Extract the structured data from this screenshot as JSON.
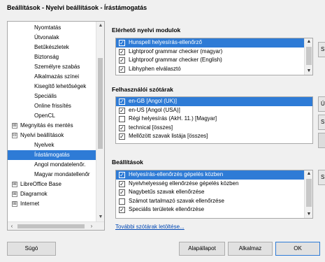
{
  "window": {
    "title": "Beállítások - Nyelvi beállítások - Írástámogatás"
  },
  "tree": {
    "items": [
      {
        "label": "Nyomtatás",
        "level": 2
      },
      {
        "label": "Útvonalak",
        "level": 2
      },
      {
        "label": "Betűkészletek",
        "level": 2
      },
      {
        "label": "Biztonság",
        "level": 2
      },
      {
        "label": "Személyre szabás",
        "level": 2
      },
      {
        "label": "Alkalmazás színei",
        "level": 2
      },
      {
        "label": "Kisegítő lehetőségek",
        "level": 2
      },
      {
        "label": "Speciális",
        "level": 2
      },
      {
        "label": "Online frissítés",
        "level": 2
      },
      {
        "label": "OpenCL",
        "level": 2
      },
      {
        "label": "Megnyitás és mentés",
        "level": 1,
        "expander": "⊞"
      },
      {
        "label": "Nyelvi beállítások",
        "level": 1,
        "expander": "⊟"
      },
      {
        "label": "Nyelvek",
        "level": 2
      },
      {
        "label": "Írástámogatás",
        "level": 2,
        "selected": true
      },
      {
        "label": "Angol mondatelenőr.",
        "level": 2
      },
      {
        "label": "Magyar mondatellenőr",
        "level": 2
      },
      {
        "label": "LibreOffice Base",
        "level": 1,
        "expander": "⊞"
      },
      {
        "label": "Diagramok",
        "level": 1,
        "expander": "⊞"
      },
      {
        "label": "Internet",
        "level": 1,
        "expander": "⊞"
      }
    ]
  },
  "modules": {
    "title": "Elérhető nyelvi modulok",
    "items": [
      {
        "label": "Hunspell helyesírás-ellenőrző",
        "checked": true,
        "selected": true
      },
      {
        "label": "Lightproof grammar checker (magyar)",
        "checked": true
      },
      {
        "label": "Lightproof grammar checker (English)",
        "checked": true
      },
      {
        "label": "Libhyphen elválasztó",
        "checked": true
      }
    ]
  },
  "dictionaries": {
    "title": "Felhasználói szótárak",
    "items": [
      {
        "label": "en-GB [Angol (UK)]",
        "checked": true,
        "selected": true
      },
      {
        "label": "en-US [Angol (USA)]",
        "checked": true
      },
      {
        "label": "Régi helyesírás (AkH. 11.) [Magyar]",
        "checked": false
      },
      {
        "label": "technical [összes]",
        "checked": true
      },
      {
        "label": "Mellőzött szavak listája [összes]",
        "checked": true
      }
    ]
  },
  "options": {
    "title": "Beállítások",
    "items": [
      {
        "label": "Helyesírás-ellenőrzés gépelés közben",
        "checked": true,
        "selected": true
      },
      {
        "label": "Nyelvhelyesség ellenőrzése gépelés közben",
        "checked": true
      },
      {
        "label": "Nagybetűs szavak ellenőrzése",
        "checked": true
      },
      {
        "label": "Számot tartalmazó szavak ellenőrzése",
        "checked": false
      },
      {
        "label": "Speciális területek ellenőrzése",
        "checked": true
      }
    ],
    "more_link": "További szótárak letöltése..."
  },
  "side_buttons": {
    "modules_edit": "S",
    "dict_new": "Ú",
    "dict_edit": "S",
    "options_edit": "S"
  },
  "buttons": {
    "help": "Súgó",
    "reset": "Alapállapot",
    "apply": "Alkalmaz",
    "ok": "OK"
  }
}
